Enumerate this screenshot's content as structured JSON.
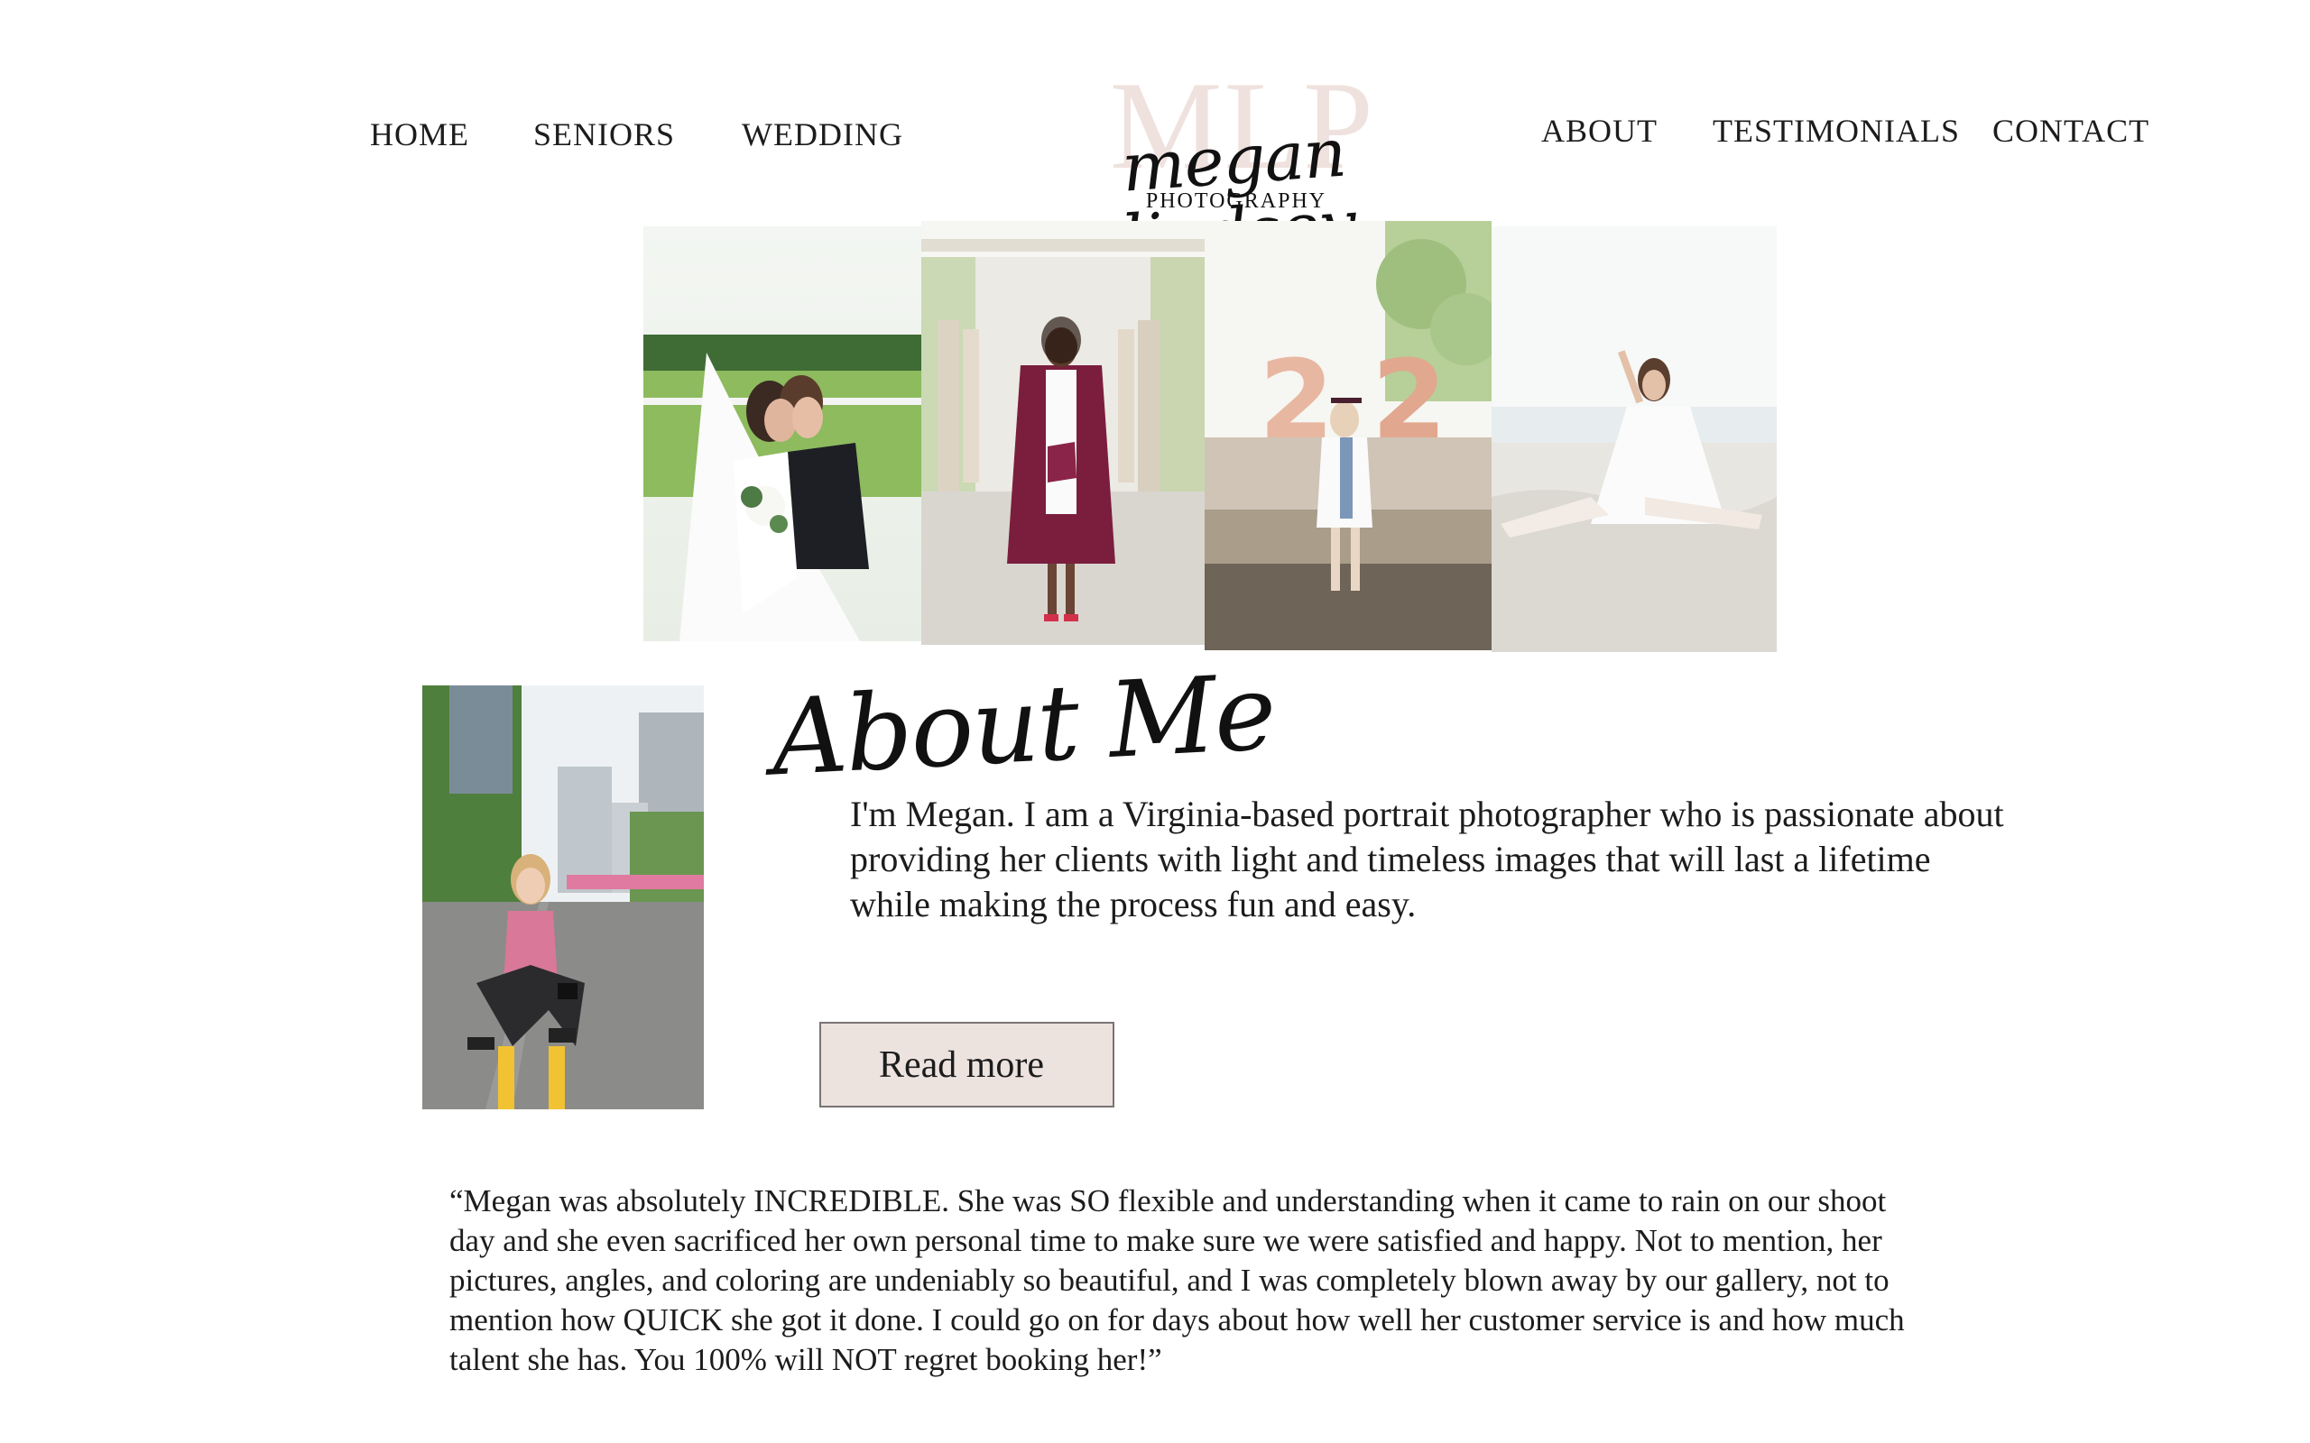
{
  "nav": {
    "left": [
      {
        "label": "HOME"
      },
      {
        "label": "SENIORS"
      },
      {
        "label": "WEDDING"
      }
    ],
    "right": [
      {
        "label": "ABOUT"
      },
      {
        "label": "TESTIMONIALS"
      },
      {
        "label": "CONTACT"
      }
    ]
  },
  "logo": {
    "monogram": "MLP",
    "script": "megan lindsey",
    "subtitle": "PHOTOGRAPHY"
  },
  "about": {
    "heading": "About Me",
    "body": "I'm Megan. I am a Virginia-based portrait photographer who is passionate about providing her clients with light and timeless images that will last a lifetime while making the process fun and easy.",
    "button_label": "Read more"
  },
  "testimonial": {
    "quote": "“Megan was absolutely INCREDIBLE. She was SO flexible and understanding when it came to rain on our shoot day and she even sacrificed her own personal time to make sure we were satisfied and happy. Not to mention, her pictures, angles, and coloring are undeniably so beautiful, and I was completely blown away by our gallery, not to mention how QUICK she got it done. I could go on for days about how well her customer service is and how much talent she has. You 100% will NOT regret booking her!”"
  },
  "colors": {
    "accent_blush": "#ece2de",
    "monogram_blush": "#efe2de",
    "text": "#1c1c1c",
    "button_border": "#7a7474"
  }
}
